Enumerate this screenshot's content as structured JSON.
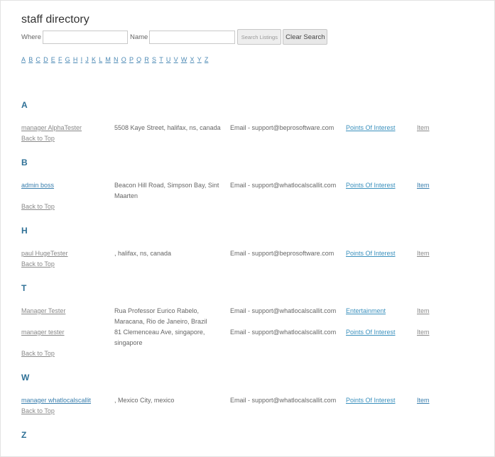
{
  "page": {
    "title": "staff directory"
  },
  "search": {
    "where_label": "Where",
    "where_value": "",
    "name_label": "Name",
    "name_value": "",
    "search_button": "Search Listings",
    "clear_button": "Clear Search"
  },
  "alphabet": [
    "A",
    "B",
    "C",
    "D",
    "E",
    "F",
    "G",
    "H",
    "I",
    "J",
    "K",
    "L",
    "M",
    "N",
    "O",
    "P",
    "Q",
    "R",
    "S",
    "T",
    "U",
    "V",
    "W",
    "X",
    "Y",
    "Z"
  ],
  "back_to_top": "Back to Top",
  "sections": [
    {
      "letter": "A",
      "rows": [
        {
          "name": "manager AlphaTester",
          "address": "5508 Kaye Street, halifax, ns, canada",
          "email": "Email - support@beprosoftware.com",
          "category": "Points Of Interest",
          "item": "Item"
        }
      ]
    },
    {
      "letter": "B",
      "rows": [
        {
          "name": "admin boss",
          "address": "Beacon Hill Road, Simpson Bay, Sint Maarten",
          "email": "Email - support@whatlocalscallit.com",
          "category": "Points Of Interest",
          "item": "Item"
        }
      ]
    },
    {
      "letter": "H",
      "rows": [
        {
          "name": "paul HugeTester",
          "address": ", halifax, ns, canada",
          "email": "Email - support@beprosoftware.com",
          "category": "Points Of Interest",
          "item": "Item"
        }
      ]
    },
    {
      "letter": "T",
      "rows": [
        {
          "name": "Manager Tester",
          "address": "Rua Professor Eurico Rabelo, Maracana, Rio de Janeiro, Brazil",
          "email": "Email - support@whatlocalscallit.com",
          "category": "Entertainment",
          "item": "Item"
        },
        {
          "name": "manager tester",
          "address": "81 Clemenceau Ave, singapore, singapore",
          "email": "Email - support@whatlocalscallit.com",
          "category": "Points Of Interest",
          "item": "Item"
        }
      ]
    },
    {
      "letter": "W",
      "rows": [
        {
          "name": "manager whatlocalscallit",
          "address": ", Mexico City, mexico",
          "email": "Email - support@whatlocalscallit.com",
          "category": "Points Of Interest",
          "item": "Item"
        }
      ]
    },
    {
      "letter": "Z",
      "rows": []
    }
  ]
}
